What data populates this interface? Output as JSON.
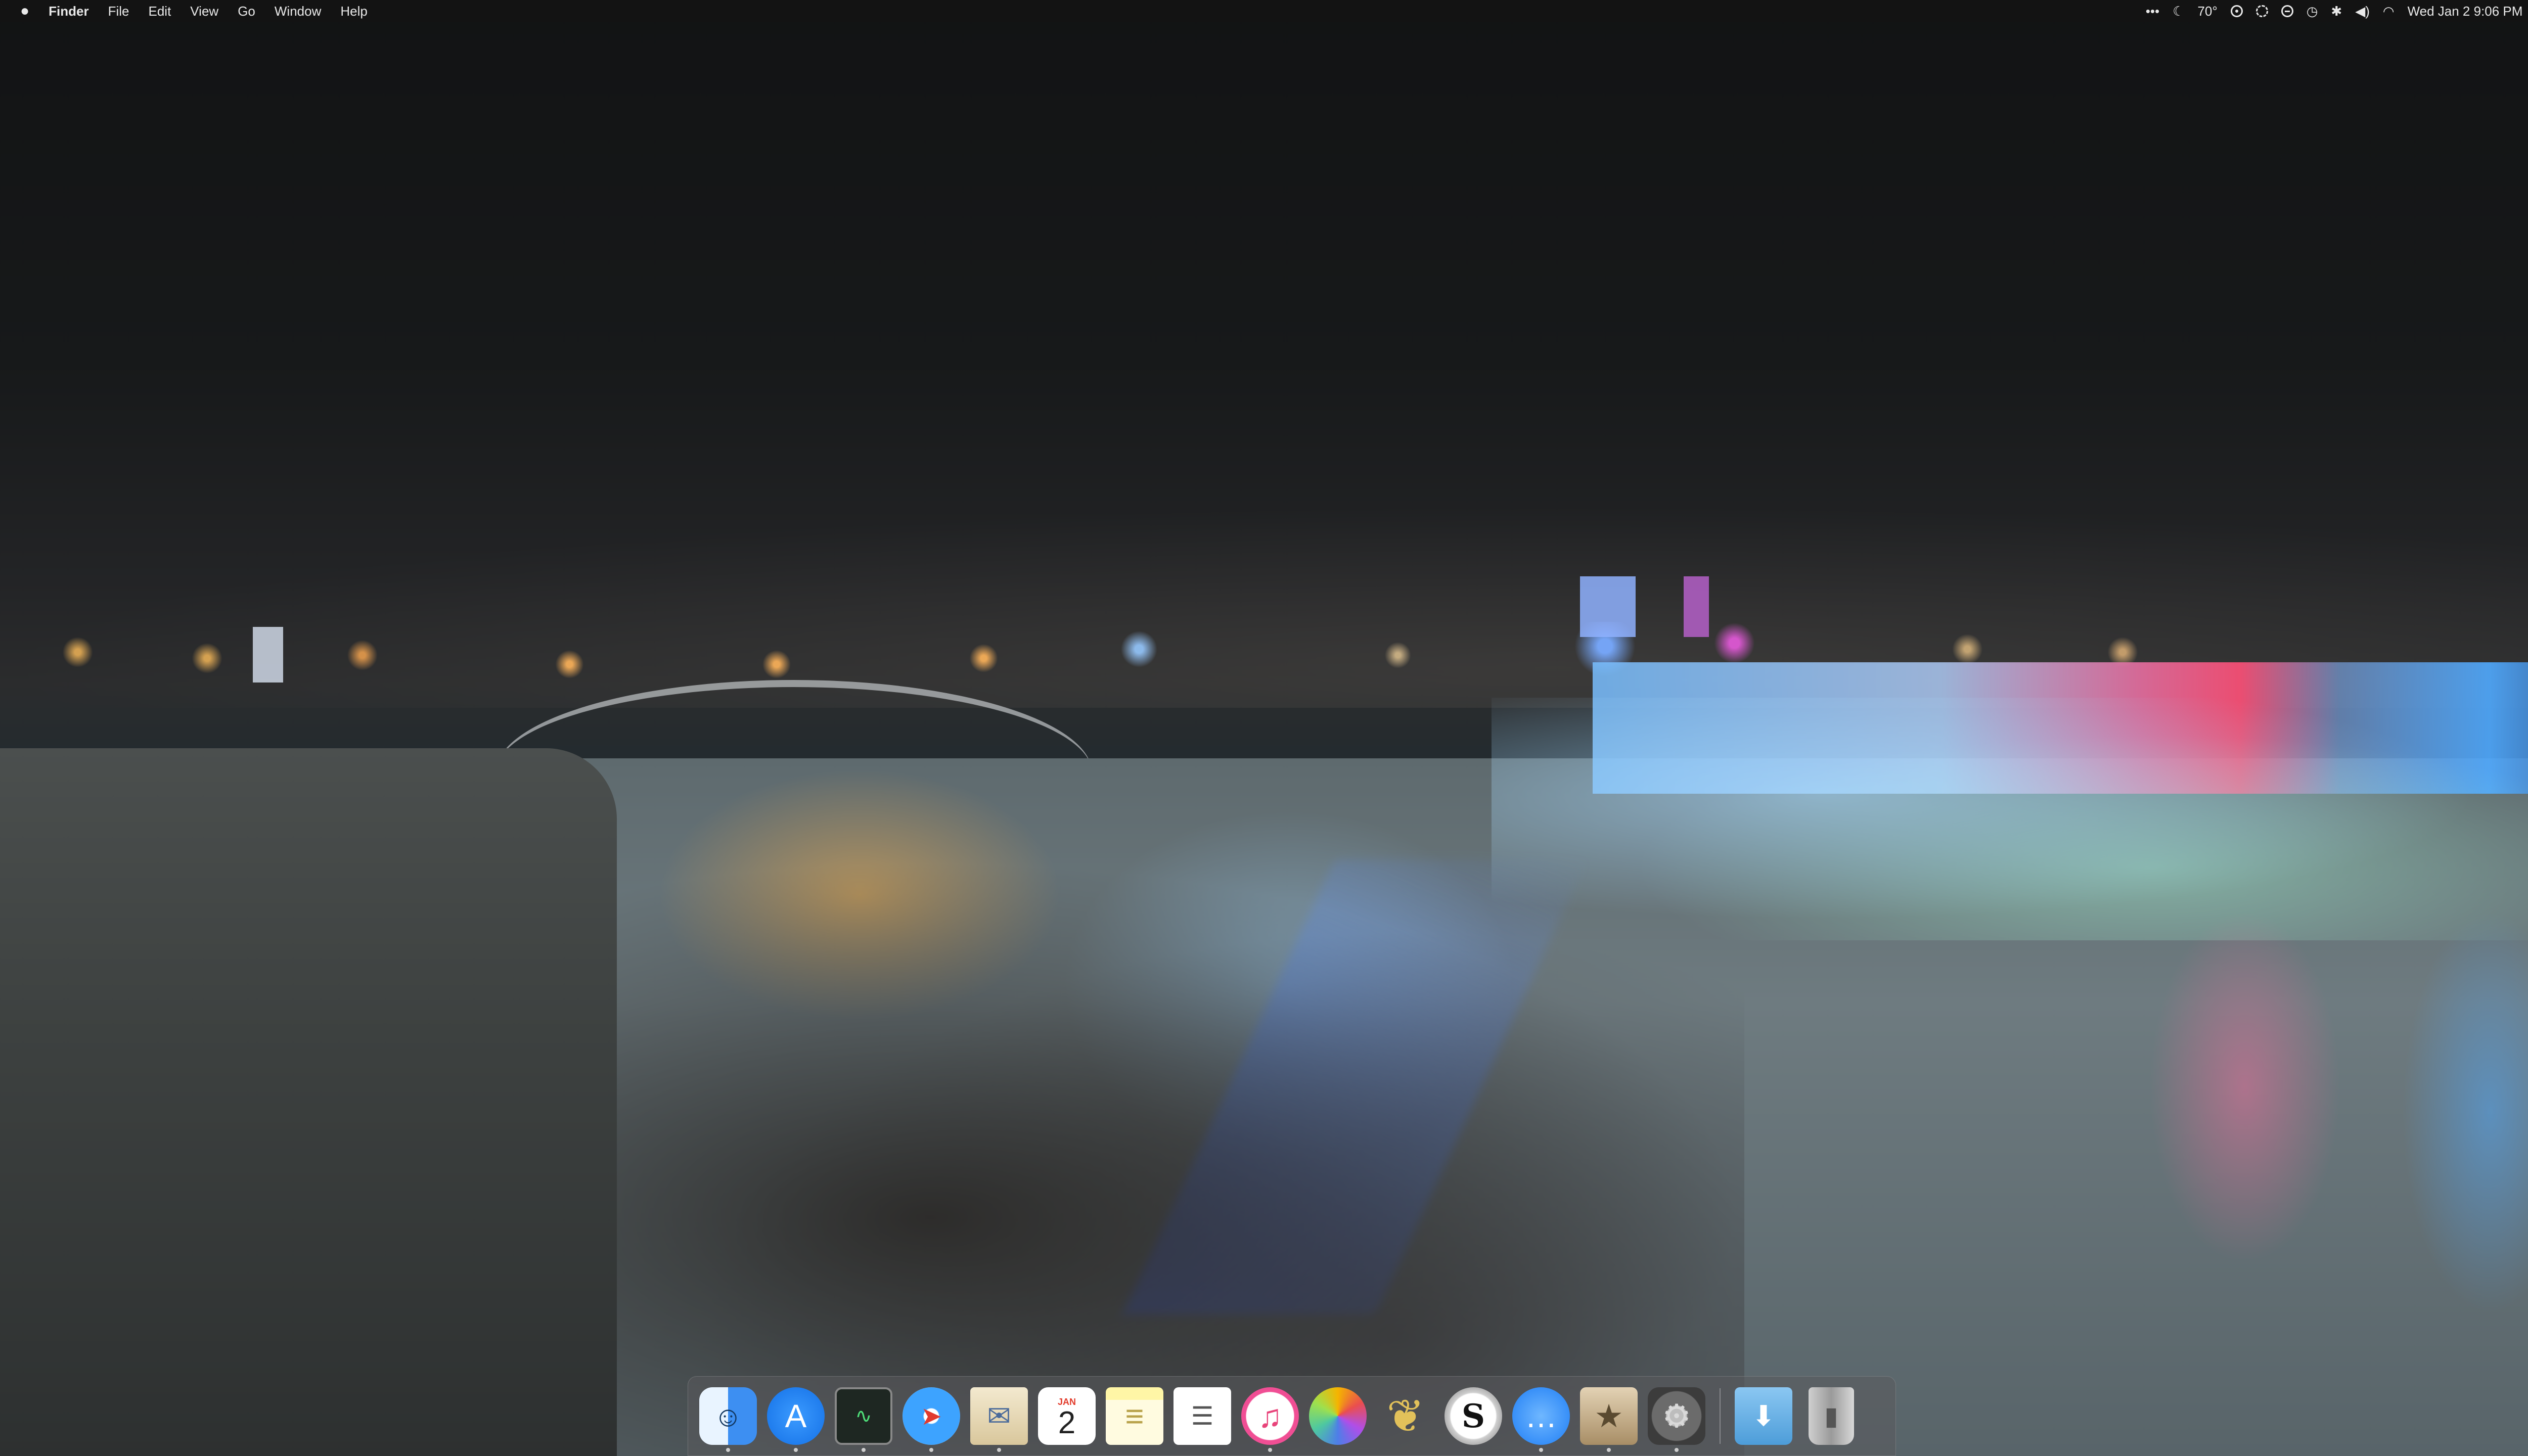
{
  "menubar": {
    "apple_icon": "apple-logo-icon",
    "app_name": "Finder",
    "menus": [
      "File",
      "Edit",
      "View",
      "Go",
      "Window",
      "Help"
    ],
    "status": {
      "overflow": "•••",
      "moon_glyph": "☾",
      "temperature": "70°",
      "datetime": "Wed Jan 2  9:06 PM"
    }
  },
  "dock": {
    "apps": [
      {
        "name": "Finder",
        "icon": "finder-icon",
        "glyph": "☺",
        "running": true
      },
      {
        "name": "App Store",
        "icon": "app-store-icon",
        "glyph": "A",
        "running": true
      },
      {
        "name": "Activity Monitor",
        "icon": "activity-monitor-icon",
        "glyph": "∿",
        "running": true
      },
      {
        "name": "Safari",
        "icon": "safari-icon",
        "glyph": "➤",
        "running": true
      },
      {
        "name": "Mail",
        "icon": "mail-icon",
        "glyph": "✉",
        "running": true
      },
      {
        "name": "Calendar",
        "icon": "calendar-icon",
        "month": "JAN",
        "day": "2",
        "running": false
      },
      {
        "name": "Notes",
        "icon": "notes-icon",
        "glyph": "≡",
        "running": false
      },
      {
        "name": "Reminders",
        "icon": "reminders-icon",
        "glyph": "☰",
        "running": false
      },
      {
        "name": "iTunes",
        "icon": "itunes-icon",
        "glyph": "♫",
        "running": true
      },
      {
        "name": "Photos",
        "icon": "photos-icon",
        "glyph": "",
        "running": false
      },
      {
        "name": "Elder Scrolls",
        "icon": "butterfly-icon",
        "glyph": "❦",
        "running": false
      },
      {
        "name": "Scrivener",
        "icon": "scrivener-icon",
        "glyph": "S",
        "running": false
      },
      {
        "name": "Messages",
        "icon": "messages-icon",
        "glyph": "…",
        "running": true
      },
      {
        "name": "Archive Utility",
        "icon": "archive-icon",
        "glyph": "★",
        "running": true
      },
      {
        "name": "System Preferences",
        "icon": "system-preferences-icon",
        "glyph": "⚙",
        "running": true
      }
    ],
    "stacks": [
      {
        "name": "Downloads",
        "icon": "downloads-folder-icon",
        "glyph": "⬇"
      },
      {
        "name": "Trash",
        "icon": "trash-icon",
        "glyph": "▮"
      }
    ]
  }
}
